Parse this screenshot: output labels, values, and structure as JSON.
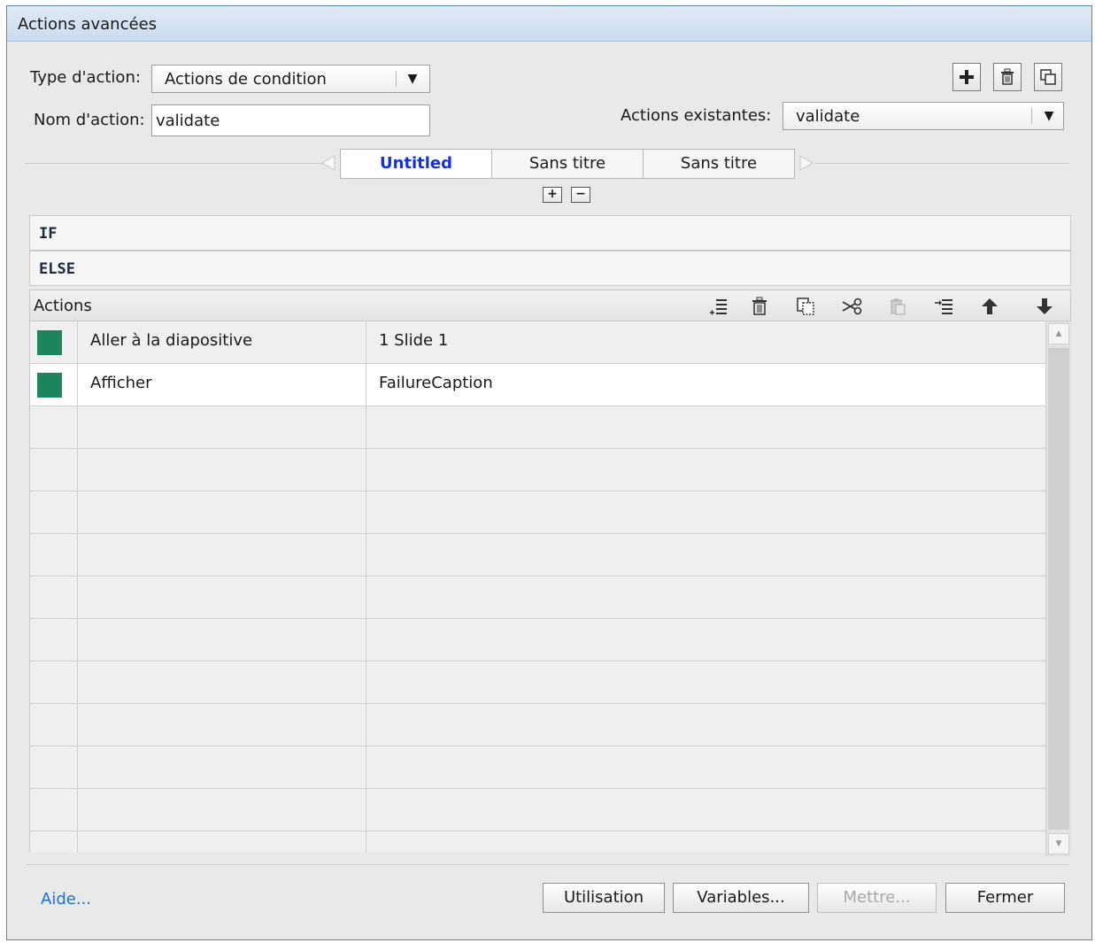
{
  "window": {
    "title": "Actions avancées"
  },
  "form": {
    "action_type_label": "Type d'action:",
    "action_type_value": "Actions de condition",
    "action_name_label": "Nom d'action:",
    "action_name_value": "validate",
    "existing_label": "Actions existantes:",
    "existing_value": "validate"
  },
  "tabs": [
    {
      "label": "Untitled",
      "active": true
    },
    {
      "label": "Sans titre",
      "active": false
    },
    {
      "label": "Sans titre",
      "active": false
    }
  ],
  "sections": {
    "if_label": "IF",
    "else_label": "ELSE"
  },
  "actions_panel": {
    "title": "Actions",
    "toolbar_icons": [
      "insert-row-icon",
      "delete-icon",
      "copy-icon",
      "cut-icon",
      "paste-icon",
      "indent-icon",
      "move-up-icon",
      "move-down-icon"
    ],
    "rows": [
      {
        "action": "Aller à la diapositive",
        "target": "1 Slide 1",
        "color": "#1c855b"
      },
      {
        "action": "Afficher",
        "target": "FailureCaption",
        "color": "#1c855b"
      },
      {
        "action": "",
        "target": ""
      },
      {
        "action": "",
        "target": ""
      },
      {
        "action": "",
        "target": ""
      },
      {
        "action": "",
        "target": ""
      },
      {
        "action": "",
        "target": ""
      },
      {
        "action": "",
        "target": ""
      },
      {
        "action": "",
        "target": ""
      },
      {
        "action": "",
        "target": ""
      },
      {
        "action": "",
        "target": ""
      },
      {
        "action": "",
        "target": ""
      },
      {
        "action": "",
        "target": ""
      }
    ]
  },
  "footer": {
    "help_link": "Aide...",
    "usage_button": "Utilisation",
    "variables_button": "Variables...",
    "put_button": "Mettre...",
    "close_button": "Fermer"
  },
  "colors": {
    "accent_tab": "#1433d6",
    "link": "#1f6fd1",
    "swatch": "#1c855b"
  }
}
